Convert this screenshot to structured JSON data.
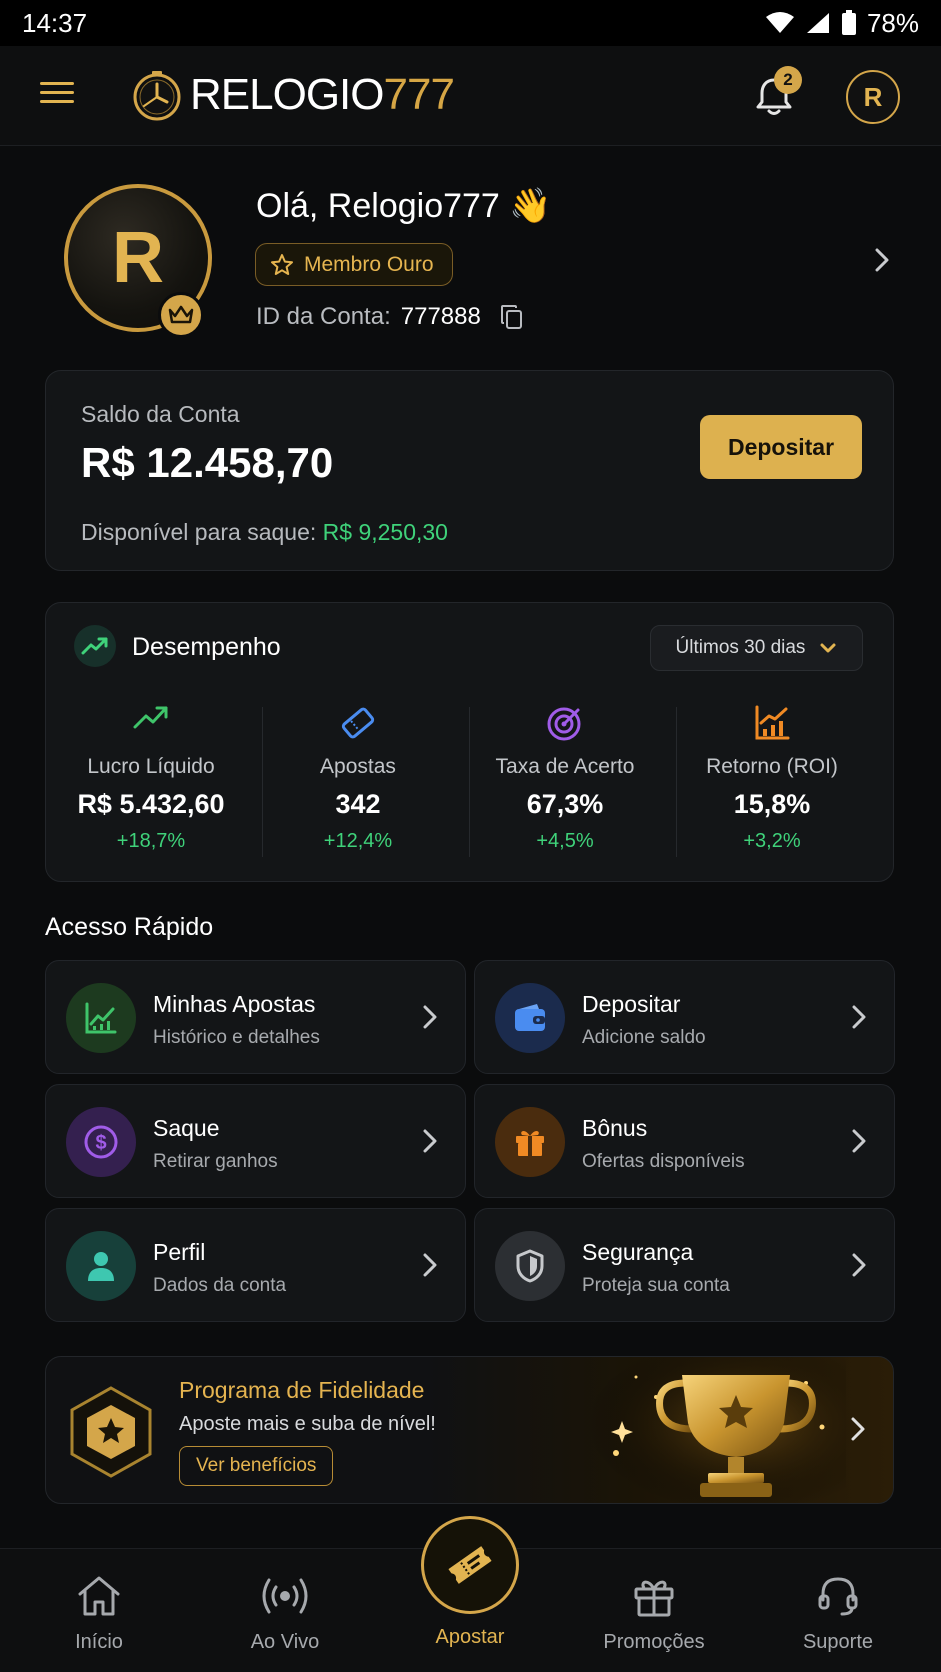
{
  "status_bar": {
    "time": "14:37",
    "battery": "78%"
  },
  "header": {
    "logo_white": "RELOGIO",
    "logo_gold": "777",
    "notification_count": "2",
    "avatar_initial": "R"
  },
  "profile": {
    "avatar_initial": "R",
    "greeting": "Olá, Relogio777 👋",
    "membership": "Membro Ouro",
    "account_id_label": "ID da Conta:",
    "account_id": "777888"
  },
  "balance": {
    "label": "Saldo da Conta",
    "value": "R$ 12.458,70",
    "deposit_button": "Depositar",
    "available_label": "Disponível para saque:",
    "available_value": "R$ 9,250,30"
  },
  "performance": {
    "title": "Desempenho",
    "range": "Últimos 30 dias",
    "metrics": [
      {
        "label": "Lucro Líquido",
        "value": "R$ 5.432,60",
        "delta": "+18,7%",
        "icon": "trend-up-icon"
      },
      {
        "label": "Apostas",
        "value": "342",
        "delta": "+12,4%",
        "icon": "ticket-icon"
      },
      {
        "label": "Taxa de Acerto",
        "value": "67,3%",
        "delta": "+4,5%",
        "icon": "target-icon"
      },
      {
        "label": "Retorno (ROI)",
        "value": "15,8%",
        "delta": "+3,2%",
        "icon": "chart-growth-icon"
      }
    ]
  },
  "quick_access": {
    "title": "Acesso Rápido",
    "items": [
      {
        "name": "Minhas Apostas",
        "sub": "Histórico e detalhes",
        "icon": "chart-icon",
        "color": "#3fc46a"
      },
      {
        "name": "Depositar",
        "sub": "Adicione saldo",
        "icon": "wallet-icon",
        "color": "#4a8cf0"
      },
      {
        "name": "Saque",
        "sub": "Retirar ganhos",
        "icon": "dollar-coin-icon",
        "color": "#a05ce8"
      },
      {
        "name": "Bônus",
        "sub": "Ofertas disponíveis",
        "icon": "gift-icon",
        "color": "#f08a24"
      },
      {
        "name": "Perfil",
        "sub": "Dados da conta",
        "icon": "user-icon",
        "color": "#3ec7b0"
      },
      {
        "name": "Segurança",
        "sub": "Proteja sua conta",
        "icon": "shield-icon",
        "color": "#c7c9cc"
      }
    ]
  },
  "loyalty": {
    "title": "Programa de Fidelidade",
    "subtitle": "Aposte mais e suba de nível!",
    "button": "Ver benefícios"
  },
  "bottom_nav": {
    "items": [
      {
        "label": "Início",
        "icon": "home-icon"
      },
      {
        "label": "Ao Vivo",
        "icon": "live-broadcast-icon"
      },
      {
        "label": "Apostar",
        "icon": "ticket-icon",
        "active": true
      },
      {
        "label": "Promoções",
        "icon": "gift-icon"
      },
      {
        "label": "Suporte",
        "icon": "headset-icon"
      }
    ]
  },
  "colors": {
    "gold": "#d4a64a",
    "green": "#3fd27a",
    "background": "#0b0c0d",
    "card": "#131517"
  }
}
